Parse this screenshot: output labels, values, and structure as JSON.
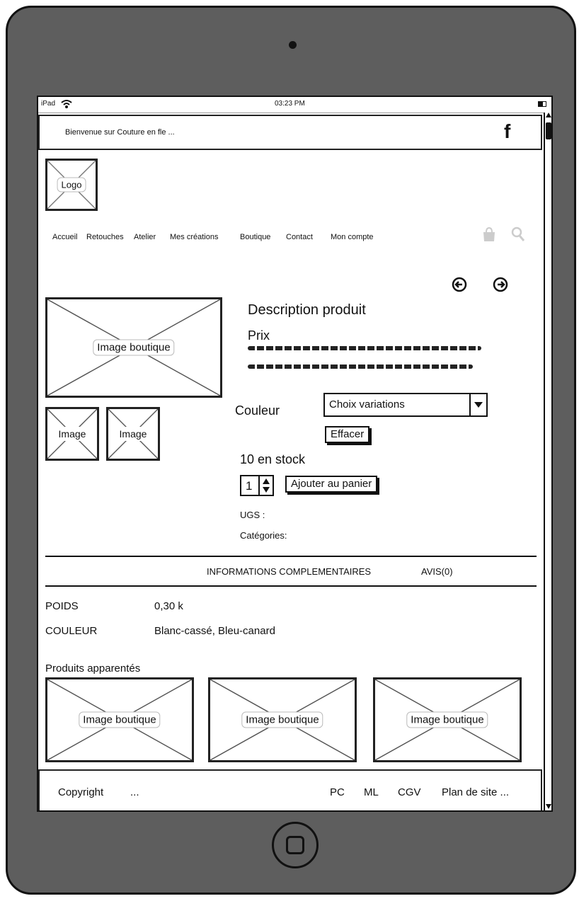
{
  "status": {
    "carrier": "iPad",
    "time": "03:23 PM"
  },
  "topbar": {
    "welcome": "Bienvenue sur Couture en fle ... ",
    "facebook_glyph": "f"
  },
  "logo": {
    "label": "Logo"
  },
  "nav": {
    "items": [
      "Accueil",
      "Retouches",
      "Atelier",
      "Mes créations",
      "Boutique",
      "Contact",
      "Mon compte"
    ]
  },
  "product": {
    "main_image_label": "Image boutique",
    "thumb_labels": [
      "Image",
      "Image"
    ],
    "title": "Description produit",
    "price_label": "Prix",
    "color_label": "Couleur",
    "variation_select": "Choix variations",
    "clear_button": "Effacer",
    "stock": "10 en stock",
    "quantity": "1",
    "add_to_cart": "Ajouter au panier",
    "sku": "UGS :",
    "categories": "Catégories:"
  },
  "tabs": {
    "info": "INFORMATIONS COMPLEMENTAIRES",
    "reviews": "AVIS(0)"
  },
  "specs": [
    {
      "label": "POIDS",
      "value": "0,30 k"
    },
    {
      "label": "COULEUR",
      "value": "Blanc-cassé, Bleu-canard"
    }
  ],
  "related": {
    "heading": "Produits apparentés",
    "labels": [
      "Image boutique",
      "Image boutique",
      "Image boutique"
    ]
  },
  "footer": {
    "copyright": "Copyright",
    "dots": "...",
    "links": [
      "PC",
      "ML",
      "CGV",
      "Plan de site ..."
    ]
  }
}
